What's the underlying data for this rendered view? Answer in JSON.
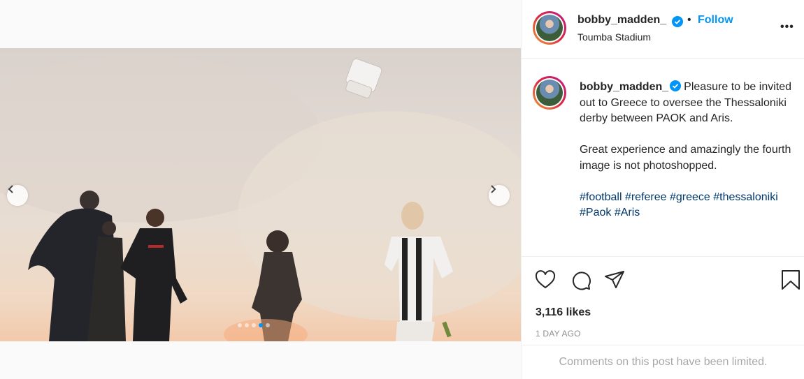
{
  "post": {
    "username": "bobby_madden_",
    "follow_label": "Follow",
    "bullet": "•",
    "location": "Toumba Stadium",
    "more_label": "•••"
  },
  "caption": {
    "username": "bobby_madden_",
    "line1": "Pleasure to be invited out to Greece to oversee the Thessaloniki derby between PAOK and Aris.",
    "line2": "Great experience and amazingly the fourth image is not photoshopped.",
    "hashtags": "#football #referee #greece #thessaloniki #Paok #Aris"
  },
  "stats": {
    "likes": "3,116 likes",
    "time": "1 DAY AGO"
  },
  "comments": {
    "limited_text": "Comments on this post have been limited."
  },
  "carousel": {
    "total_slides": 5,
    "active_slide": 4
  },
  "icons": {
    "verified": "verified-badge-icon",
    "like": "heart-icon",
    "comment": "comment-bubble-icon",
    "share": "paper-plane-icon",
    "save": "bookmark-icon",
    "prev": "chevron-left-icon",
    "next": "chevron-right-icon"
  },
  "colors": {
    "accent": "#0095f6",
    "hashtag": "#00376b",
    "muted": "#8e8e8e"
  }
}
